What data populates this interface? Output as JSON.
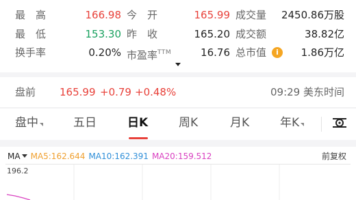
{
  "stats": {
    "high_label": "最　高",
    "high_value": "166.98",
    "open_label": "今　开",
    "open_value": "165.99",
    "volume_label": "成交量",
    "volume_value": "2450.86万股",
    "low_label": "最　低",
    "low_value": "153.30",
    "prev_close_label": "昨　收",
    "prev_close_value": "165.20",
    "turnover_label": "成交额",
    "turnover_value": "38.82亿",
    "turnover_rate_label": "换手率",
    "turnover_rate_value": "0.20%",
    "pe_label": "市盈率",
    "pe_suffix": "TTM",
    "pe_value": "16.76",
    "market_cap_label": "总市值",
    "market_cap_icon": "info-icon",
    "market_cap_value": "1.86万亿",
    "expand_icon": "caret-down-icon"
  },
  "premarket": {
    "label": "盘前",
    "price": "165.99",
    "change": "+0.79",
    "change_pct": "+0.48%",
    "time": "09:29 美东时间"
  },
  "tabs": {
    "items": [
      "盘中",
      "五日",
      "日K",
      "周K",
      "月K",
      "年K"
    ],
    "active": "日K",
    "settings_icon": "settings-sliders-icon"
  },
  "chart": {
    "indicator": "MA",
    "ma5": "MA5:162.644",
    "ma10": "MA10:162.391",
    "ma20": "MA20:159.512",
    "adjust": "前复权",
    "y_max": "196.2"
  },
  "colors": {
    "up": "#e8413a",
    "down": "#19a15f",
    "ma5": "#f0a030",
    "ma10": "#2e8ed8",
    "ma20": "#d940c0",
    "info": "#f5a623"
  }
}
